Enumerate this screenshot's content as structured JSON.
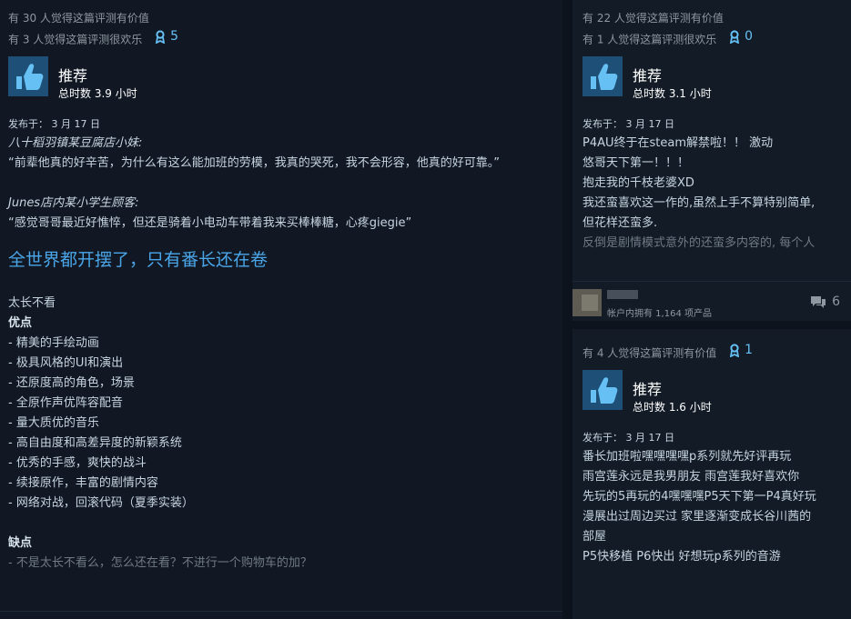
{
  "left": {
    "helpful_line": "有 30 人觉得这篇评测有价值",
    "funny_line": "有 3 人觉得这篇评测很欢乐",
    "award_count": "5",
    "recommend": "推荐",
    "hours": "总时数 3.9 小时",
    "posted": "发布于：  3 月 17 日",
    "lines": [
      "八十稻羽镇某豆腐店小妹:",
      "“前辈他真的好辛苦，为什么有这么能加班的劳模，我真的哭死，我不会形容，他真的好可靠。”",
      "Junes店内某小学生顾客:",
      "“感觉哥哥最近好憔悴，但还是骑着小电动车带着我来买棒棒糖，心疼giegie”",
      "全世界都开摆了，只有番长还在卷",
      "太长不看",
      "优点",
      "- 精美的手绘动画",
      "- 极具风格的UI和演出",
      "- 还原度高的角色，场景",
      "- 全原作声优阵容配音",
      "- 量大质优的音乐",
      "- 高自由度和高差异度的新颖系统",
      "- 优秀的手感，爽快的战斗",
      "- 续接原作，丰富的剧情内容",
      "- 网络对战，回滚代码（夏季实装）",
      "缺点",
      "- 不是太长不看么，怎么还在看？不进行一个购物车的加？"
    ]
  },
  "right_top": {
    "helpful_line": "有 22 人觉得这篇评测有价值",
    "funny_line": "有 1 人觉得这篇评测很欢乐",
    "award_count": "0",
    "recommend": "推荐",
    "hours": "总时数 3.1 小时",
    "posted": "发布于：  3 月 17 日",
    "lines": [
      "P4AU终于在steam解禁啦！！ 激动",
      "悠哥天下第一！！！",
      "抱走我的千枝老婆XD",
      "我还蛮喜欢这一作的,虽然上手不算特别简单,",
      "但花样还蛮多.",
      "反倒是剧情模式意外的还蛮多内容的, 每个人"
    ],
    "owned_text": "帐户内拥有 1,164 项产品",
    "comment_count": "6"
  },
  "right_bottom": {
    "helpful_line": "有 4 人觉得这篇评测有价值",
    "award_count": "1",
    "recommend": "推荐",
    "hours": "总时数 1.6 小时",
    "posted": "发布于：  3 月 17 日",
    "lines": [
      "番长加班啦嘿嘿嘿嘿p系列就先好评再玩",
      "雨宫莲永远是我男朋友 雨宫莲我好喜欢你",
      "先玩的5再玩的4嘿嘿嘿P5天下第一P4真好玩",
      "漫展出过周边买过 家里逐渐变成长谷川茜的",
      "部屋",
      "P5快移植 P6快出 好想玩p系列的音游"
    ]
  },
  "icons": {
    "award": "award-ribbon-icon",
    "thumb": "thumbs-up-icon",
    "comment": "comment-bubble-icon"
  },
  "colors": {
    "accent": "#66c0f4",
    "heading_blue": "#4aa6e8",
    "thumb_bg": "#1e4f77"
  }
}
